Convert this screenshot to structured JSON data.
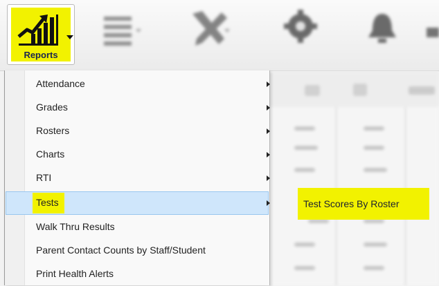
{
  "toolbar": {
    "reports": {
      "label": "Reports",
      "icon": "bar-chart-icon",
      "highlight_color": "#f2f200"
    },
    "blurred_tools": [
      {
        "name": "menu-lines-icon"
      },
      {
        "name": "tools-icon"
      },
      {
        "name": "gear-icon"
      },
      {
        "name": "bell-icon"
      }
    ]
  },
  "menu": {
    "items": [
      {
        "label": "Attendance",
        "has_submenu": true
      },
      {
        "label": "Grades",
        "has_submenu": true
      },
      {
        "label": "Rosters",
        "has_submenu": true
      },
      {
        "label": "Charts",
        "has_submenu": true
      },
      {
        "label": "RTI",
        "has_submenu": true
      },
      {
        "label": "Tests",
        "has_submenu": true,
        "active": true
      },
      {
        "label": "Walk Thru Results",
        "has_submenu": false
      },
      {
        "label": "Parent Contact Counts by Staff/Student",
        "has_submenu": false
      },
      {
        "label": "Print Health Alerts",
        "has_submenu": false
      }
    ],
    "active_color": "#cfe6fb"
  },
  "submenu": {
    "items": [
      {
        "label": "Test Scores By Roster"
      }
    ]
  }
}
